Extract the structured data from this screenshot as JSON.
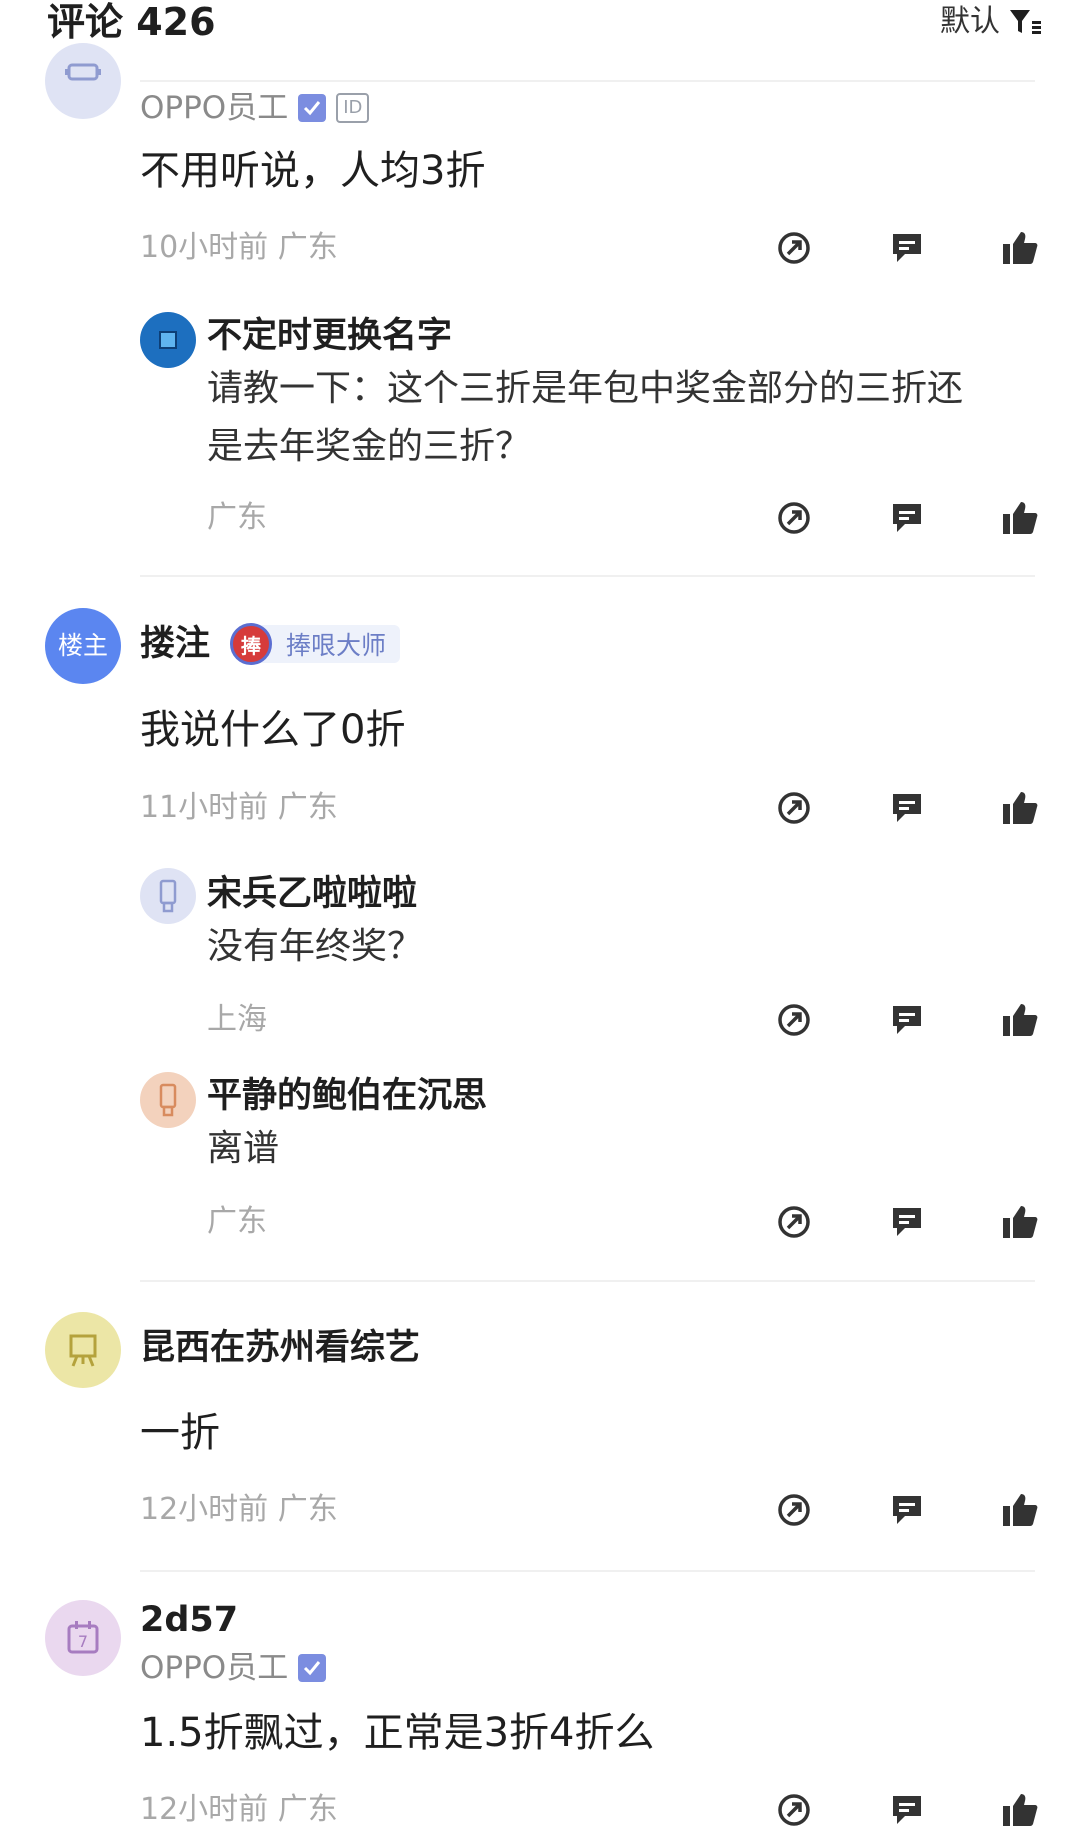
{
  "header": {
    "title": "评论 426",
    "sort_label": "默认"
  },
  "comments": [
    {
      "role": "OPPO员工",
      "id_badge": "ID",
      "content": "不用听说，人均3折",
      "meta": "10小时前  广东",
      "replies": [
        {
          "username": "不定时更换名字",
          "line1": "请教一下：这个三折是年包中奖金部分的三折还",
          "line2": "是去年奖金的三折？",
          "meta": "广东"
        }
      ]
    },
    {
      "avatar_text": "楼主",
      "username": "搂注",
      "medal_icon_text": "捧",
      "medal_text": "捧哏大师",
      "content": "我说什么了0折",
      "meta": "11小时前  广东",
      "replies": [
        {
          "username": "宋兵乙啦啦啦",
          "text": "没有年终奖？",
          "meta": "上海"
        },
        {
          "username": "平静的鲍伯在沉思",
          "text": "离谱",
          "meta": "广东"
        }
      ]
    },
    {
      "username": "昆西在苏州看综艺",
      "content": "一折",
      "meta": "12小时前  广东"
    },
    {
      "avatar_text": "7",
      "username": "2d57",
      "role": "OPPO员工",
      "content": "1.5折飘过，正常是3折4折么",
      "meta": "12小时前  广东"
    }
  ],
  "icons": {
    "share": "share-icon",
    "reply": "reply-icon",
    "like": "like-icon",
    "sort": "filter-sort-icon"
  },
  "colors": {
    "accent": "#5b6ed1",
    "meta": "#a8a8a8",
    "verified": "#7b8de0"
  }
}
